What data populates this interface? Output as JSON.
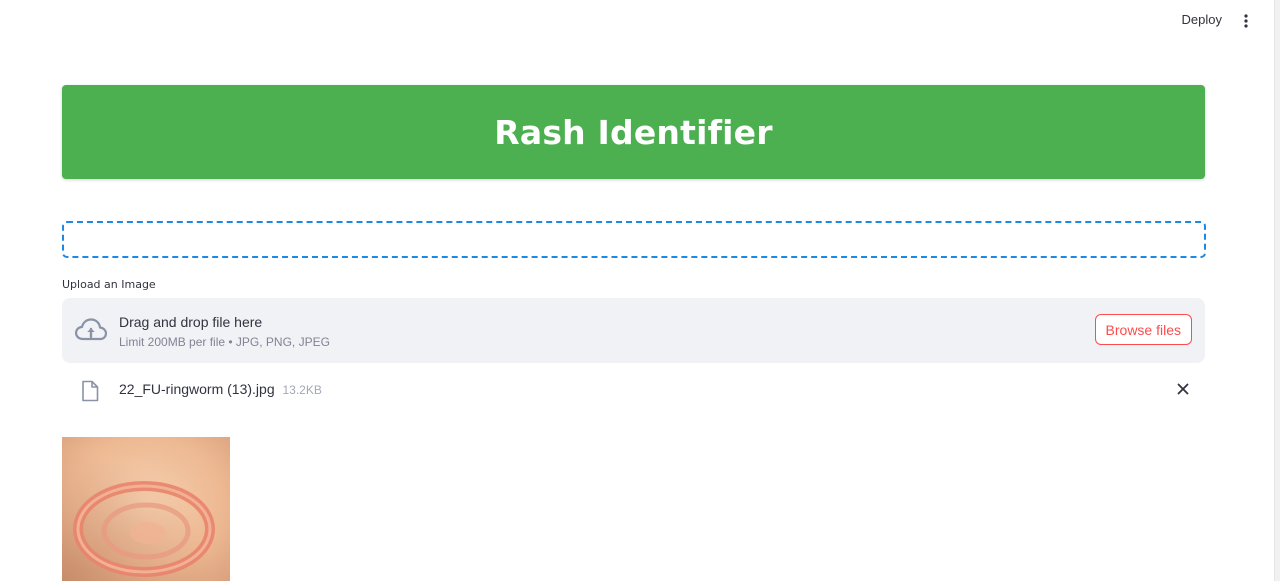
{
  "topbar": {
    "deploy_label": "Deploy",
    "menu_icon": "vertical-dots-icon"
  },
  "banner": {
    "title": "Rash Identifier",
    "bg_color": "#4caf50"
  },
  "uploader": {
    "label": "Upload an Image",
    "drop_title": "Drag and drop file here",
    "drop_subtitle": "Limit 200MB per file • JPG, PNG, JPEG",
    "browse_label": "Browse files",
    "icon": "cloud-upload-icon",
    "accent_color": "#ff4b4b"
  },
  "uploaded_file": {
    "name": "22_FU-ringworm (13).jpg",
    "size": "13.2KB",
    "icon": "file-icon",
    "remove_icon": "close-icon"
  },
  "preview": {
    "icon": "rash-photo"
  }
}
